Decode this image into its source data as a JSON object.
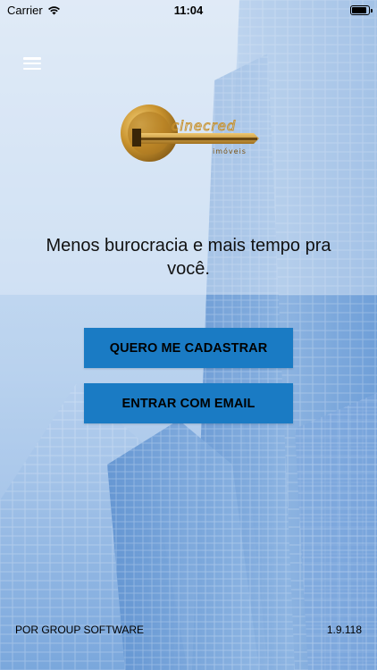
{
  "status_bar": {
    "carrier": "Carrier",
    "time": "11:04",
    "battery_level": 1.0
  },
  "menu": {
    "icon": "hamburger-menu-icon"
  },
  "logo": {
    "brand": "Cinecred",
    "subtitle": "Imóveis"
  },
  "tagline": "Menos burocracia e mais tempo pra você.",
  "buttons": {
    "register_label": "QUERO ME CADASTRAR",
    "login_label": "ENTRAR COM EMAIL"
  },
  "footer": {
    "credit": "POR GROUP SOFTWARE",
    "version": "1.9.118"
  },
  "colors": {
    "button_bg": "#1a7bc4",
    "logo_gold": "#c89a3a"
  }
}
